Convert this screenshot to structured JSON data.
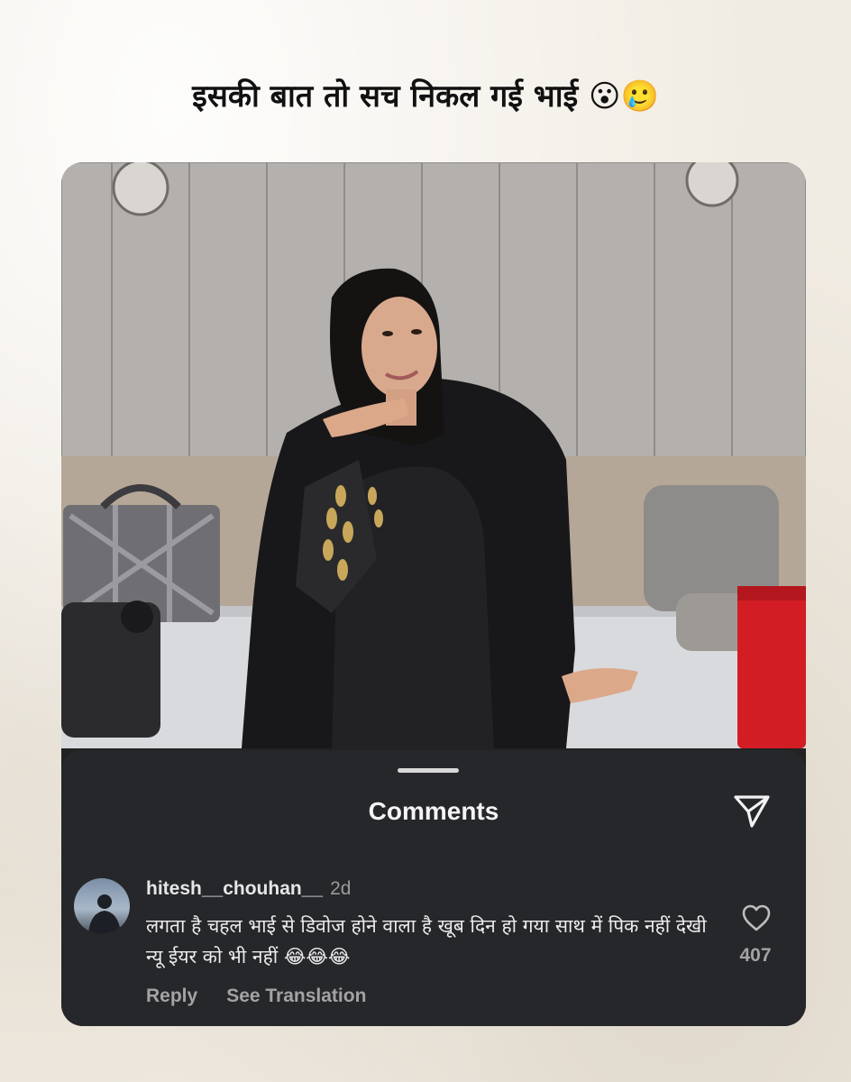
{
  "headline": "इसकी बात तो सच निकल गई भाई 😮🥲",
  "photo": {
    "alt": "Woman in black outfit posing on a sofa"
  },
  "comments_sheet": {
    "title": "Comments",
    "send_icon": "paper-plane-icon"
  },
  "comment": {
    "author": "hitesh__chouhan__",
    "time": "2d",
    "text": "लगता है चहल भाई से डिवोज होने वाला है खूब दिन हो गया साथ में पिक नहीं देखी न्यू ईयर को भी नहीं 😂😂😂",
    "reply_label": "Reply",
    "translation_label": "See Translation",
    "like_icon": "heart-icon",
    "like_count": "407"
  },
  "colors": {
    "background": "#f1ece3",
    "sheet": "#26272a",
    "primary_text": "#ececec",
    "secondary_text": "#a3a3a3"
  }
}
